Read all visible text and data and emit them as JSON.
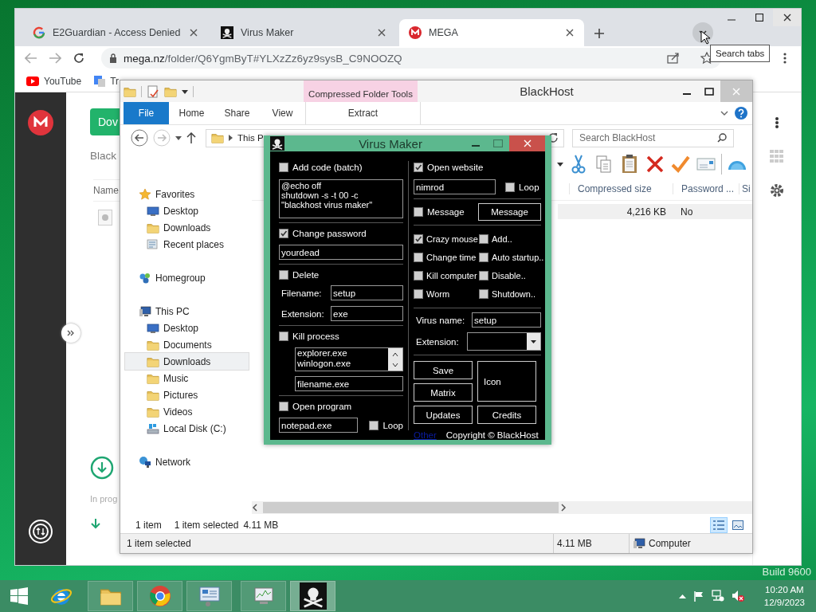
{
  "desktop": {
    "build": "Build 9600"
  },
  "browser": {
    "tabs": [
      {
        "title": "E2Guardian - Access Denied",
        "selected": false
      },
      {
        "title": "Virus Maker",
        "selected": false
      },
      {
        "title": "MEGA",
        "selected": true
      }
    ],
    "tooltip": "Search tabs",
    "url_host": "mega.nz",
    "url_path": "/folder/Q6YgmByT#YLXzZz6yz9sysB_C9NOOZQ",
    "bookmarks": [
      "YouTube",
      "Tr"
    ]
  },
  "mega": {
    "button": "Dov",
    "folder": "Black",
    "column": "Name",
    "transfers": "In prog"
  },
  "explorer": {
    "title": "BlackHost",
    "context_tab": "Compressed Folder Tools",
    "file_tab": "File",
    "ribbon_tabs": [
      "Home",
      "Share",
      "View"
    ],
    "context_ribbon_tab": "Extract",
    "breadcrumb": "This P",
    "search_placeholder": "Search BlackHost",
    "columns": [
      "Compressed size",
      "Password ...",
      "Si"
    ],
    "file": {
      "cells": [
        "4,216 KB",
        "No"
      ],
      "selected": true
    },
    "nav": [
      {
        "label": "Favorites",
        "selected": false,
        "children": [
          {
            "label": "Desktop",
            "selected": false
          },
          {
            "label": "Downloads",
            "selected": false
          },
          {
            "label": "Recent places",
            "selected": false
          }
        ]
      },
      {
        "label": "Homegroup",
        "selected": false
      },
      {
        "label": "This PC",
        "selected": false,
        "children": [
          {
            "label": "Desktop",
            "selected": false
          },
          {
            "label": "Documents",
            "selected": false
          },
          {
            "label": "Downloads",
            "selected": true
          },
          {
            "label": "Music",
            "selected": false
          },
          {
            "label": "Pictures",
            "selected": false
          },
          {
            "label": "Videos",
            "selected": false
          },
          {
            "label": "Local Disk (C:)",
            "selected": false
          }
        ]
      },
      {
        "label": "Network",
        "selected": false
      }
    ],
    "item_count": "1 item",
    "selection": "1 item selected",
    "selection_size": "4.11 MB",
    "status": {
      "text": "1 item selected",
      "size": "4.11 MB",
      "location": "Computer"
    }
  },
  "virus_maker": {
    "title": "Virus Maker",
    "add_code": {
      "label": "Add code (batch)",
      "checked": false,
      "code": "@echo off\nshutdown -s -t 00 -c \"blackhost virus maker\""
    },
    "change_password": {
      "label": "Change password",
      "checked": true,
      "value": "yourdead"
    },
    "delete": {
      "label": "Delete",
      "checked": false,
      "filename_label": "Filename:",
      "filename": "setup",
      "extension_label": "Extension:",
      "extension": "exe"
    },
    "kill_process": {
      "label": "Kill process",
      "checked": false,
      "processes": [
        "explorer.exe",
        "winlogon.exe"
      ],
      "value": "filename.exe"
    },
    "open_program": {
      "label": "Open program",
      "checked": false,
      "value": "notepad.exe",
      "loop": {
        "label": "Loop",
        "checked": false
      }
    },
    "open_website": {
      "label": "Open website",
      "checked": true,
      "value": "nimrod",
      "loop": {
        "label": "Loop",
        "checked": false
      }
    },
    "message": {
      "label": "Message",
      "checked": false,
      "button": "Message"
    },
    "options": [
      {
        "label": "Crazy mouse",
        "checked": true
      },
      {
        "label": "Add..",
        "checked": false
      },
      {
        "label": "Change time",
        "checked": false
      },
      {
        "label": "Auto startup..",
        "checked": false
      },
      {
        "label": "Kill computer",
        "checked": false
      },
      {
        "label": "Disable..",
        "checked": false
      },
      {
        "label": "Worm",
        "checked": false
      },
      {
        "label": "Shutdown..",
        "checked": false
      }
    ],
    "virus_name_label": "Virus name:",
    "virus_name": "setup",
    "extension_label": "Extension:",
    "buttons": [
      "Save",
      "Matrix",
      "Icon",
      "Updates",
      "Credits"
    ],
    "link": "Other",
    "copyright": "Copyright © BlackHost"
  },
  "taskbar": {
    "apps": [
      {
        "selected": false
      },
      {
        "selected": false
      },
      {
        "selected": false
      },
      {
        "selected": false
      },
      {
        "selected": true
      }
    ],
    "time": "10:20 AM",
    "date": "12/9/2023"
  }
}
